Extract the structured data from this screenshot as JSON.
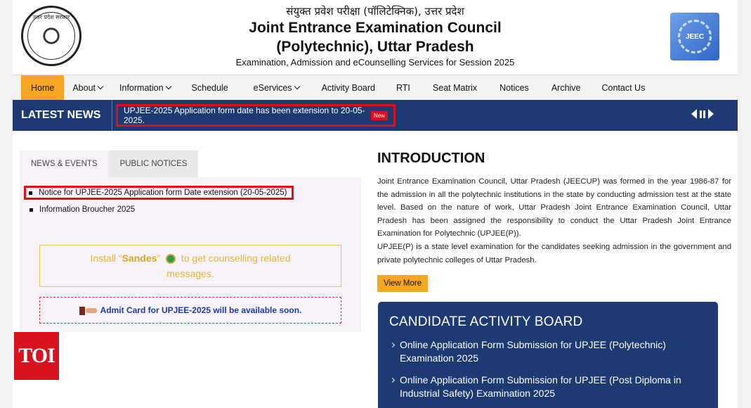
{
  "header": {
    "hindi_title": "संयुक्त प्रवेश परीक्षा (पॉलिटेक्निक), उत्तर प्रदेश",
    "title_line1": "Joint Entrance Examination Council",
    "title_line2": "(Polytechnic), Uttar Pradesh",
    "subtitle": "Examination, Admission and eCounselling Services for Session 2025",
    "emblem_text": "उत्तर प्रदेश सरकार",
    "logo_text": "JEEC"
  },
  "nav": {
    "items": [
      {
        "label": "Home",
        "active": true
      },
      {
        "label": "About",
        "dropdown": true
      },
      {
        "label": "Information",
        "dropdown": true
      },
      {
        "label": "Schedule"
      },
      {
        "label": "eServices",
        "dropdown": true
      },
      {
        "label": "Activity Board"
      },
      {
        "label": "RTI"
      },
      {
        "label": "Seat Matrix"
      },
      {
        "label": "Notices"
      },
      {
        "label": "Archive"
      },
      {
        "label": "Contact Us"
      }
    ]
  },
  "latest_news": {
    "label": "LATEST NEWS",
    "item": "UPJEE-2025 Application form date has been extension to 20-05-2025.",
    "badge": "New"
  },
  "left_panel": {
    "tabs": [
      "NEWS & EVENTS",
      "PUBLIC NOTICES"
    ],
    "notices": [
      "Notice for UPJEE-2025 Application form Date extension (20-05-2025)",
      "Information Broucher 2025"
    ],
    "sandes": {
      "prefix": "Install “",
      "app": "Sandes",
      "quote_close": "”",
      "suffix": "to get counselling related",
      "line2": "messages."
    },
    "admit_card": "Admit Card for UPJEE-2025 will be available soon."
  },
  "intro": {
    "title": "INTRODUCTION",
    "para1": "Joint Entrance Examination Council, Uttar Pradesh (JEECUP) was formed in the year 1986-87 for the admission in all the polytechnic institutions in the state by conducting admission test at the state level. Based on the nature of work, Uttar Pradesh Joint Entrance Examination Council, Uttar Pradesh has been assigned the responsibility to conduct the Uttar Pradesh Joint Entrance Examination for Polytechnic (UPJEE(P)).",
    "para2": "UPJEE(P) is a state level examination for the candidates seeking admission in the government and private polytechnic colleges of Uttar Pradesh.",
    "view_more": "View More"
  },
  "board": {
    "title": "CANDIDATE ACTIVITY BOARD",
    "items": [
      "Online Application Form Submission for UPJEE (Polytechnic) Examination 2025",
      "Online Application Form Submission for UPJEE (Post Diploma in Industrial Safety) Examination 2025"
    ]
  },
  "watermark": "TOI",
  "colors": {
    "navy": "#1e3a73",
    "accent": "#f5a623",
    "highlight": "#e0101a"
  }
}
